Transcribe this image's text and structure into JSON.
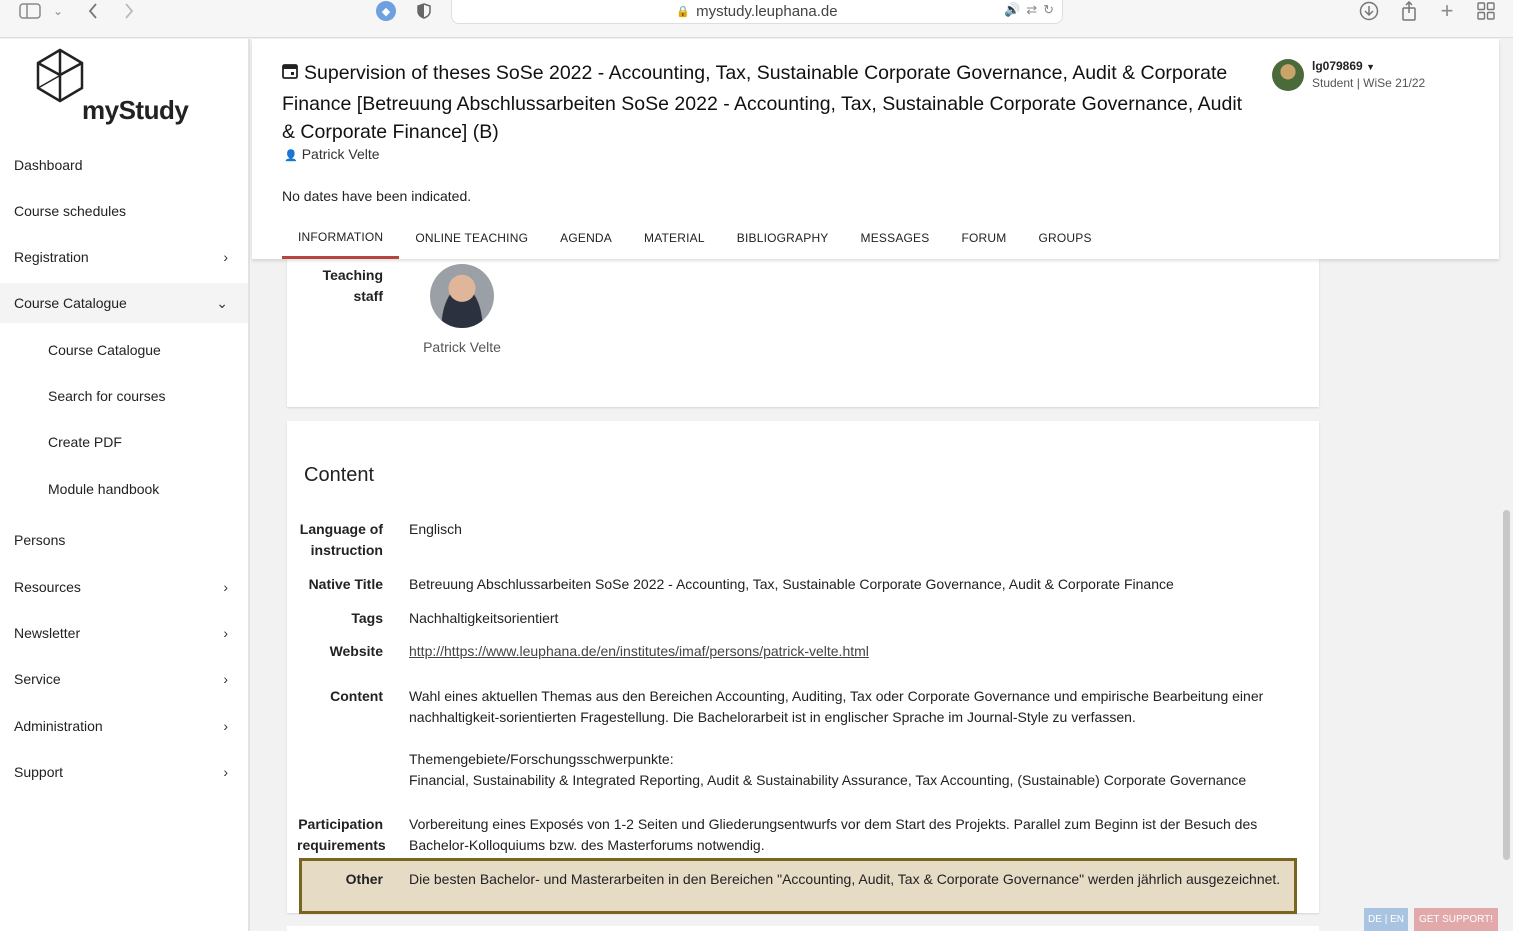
{
  "browser": {
    "url": "mystudy.leuphana.de"
  },
  "logo": {
    "text": "myStudy"
  },
  "sidebar": {
    "items": [
      {
        "label": "Dashboard"
      },
      {
        "label": "Course schedules"
      },
      {
        "label": "Registration"
      },
      {
        "label": "Course Catalogue"
      },
      {
        "label": "Course Catalogue"
      },
      {
        "label": "Search for courses"
      },
      {
        "label": "Create PDF"
      },
      {
        "label": "Module handbook"
      },
      {
        "label": "Persons"
      },
      {
        "label": "Resources"
      },
      {
        "label": "Newsletter"
      },
      {
        "label": "Service"
      },
      {
        "label": "Administration"
      },
      {
        "label": "Support"
      }
    ]
  },
  "header": {
    "title": "Supervision of theses SoSe 2022 - Accounting, Tax, Sustainable Corporate Governance, Audit & Corporate Finance [Betreuung Abschlussarbeiten SoSe 2022 - Accounting, Tax, Sustainable Corporate Governance, Audit & Corporate Finance] (B)",
    "lecturer": "Patrick Velte",
    "no_dates": "No dates have been indicated.",
    "tabs": [
      {
        "label": "INFORMATION"
      },
      {
        "label": "ONLINE TEACHING"
      },
      {
        "label": "AGENDA"
      },
      {
        "label": "MATERIAL"
      },
      {
        "label": "BIBLIOGRAPHY"
      },
      {
        "label": "MESSAGES"
      },
      {
        "label": "FORUM"
      },
      {
        "label": "GROUPS"
      }
    ]
  },
  "user": {
    "name": "lg079869",
    "role": "Student  | WiSe 21/22"
  },
  "teaching": {
    "label_line1": "Teaching",
    "label_line2": "staff",
    "name": "Patrick Velte"
  },
  "content": {
    "section_title": "Content",
    "rows": {
      "language_label_1": "Language of",
      "language_label_2": "instruction",
      "language": "Englisch",
      "native_title_label": "Native Title",
      "native_title": "Betreuung Abschlussarbeiten SoSe 2022 - Accounting, Tax, Sustainable Corporate Governance, Audit & Corporate Finance",
      "tags_label": "Tags",
      "tags": "Nachhaltigkeitsorientiert",
      "website_label": "Website",
      "website": "http://https://www.leuphana.de/en/institutes/imaf/persons/patrick-velte.html",
      "content_label": "Content",
      "content_p1": "Wahl eines aktuellen Themas aus den Bereichen Accounting, Auditing, Tax oder Corporate Governance und empirische Bearbeitung einer nachhaltigkeit-sorientierten Fragestellung. Die Bachelorarbeit ist in englischer Sprache im Journal-Style zu verfassen.",
      "content_p2_1": "Themengebiete/Forschungsschwerpunkte:",
      "content_p2_2": "Financial, Sustainability & Integrated Reporting, Audit & Sustainability Assurance, Tax Accounting, (Sustainable) Corporate Governance",
      "participation_label_1": "Participation",
      "participation_label_2": "requirements",
      "participation": "Vorbereitung eines Exposés von 1-2 Seiten und Gliederungsentwurfs vor dem Start des Projekts. Parallel zum Beginn ist der Besuch des Bachelor-Kolloquiums bzw. des Masterforums notwendig.",
      "other_label": "Other",
      "other": "Die besten Bachelor- und Masterarbeiten in den Bereichen \"Accounting, Audit, Tax & Corporate Governance\" werden jährlich ausgezeichnet."
    }
  },
  "footer": {
    "lang": "DE | EN",
    "support": "GET SUPPORT!"
  }
}
